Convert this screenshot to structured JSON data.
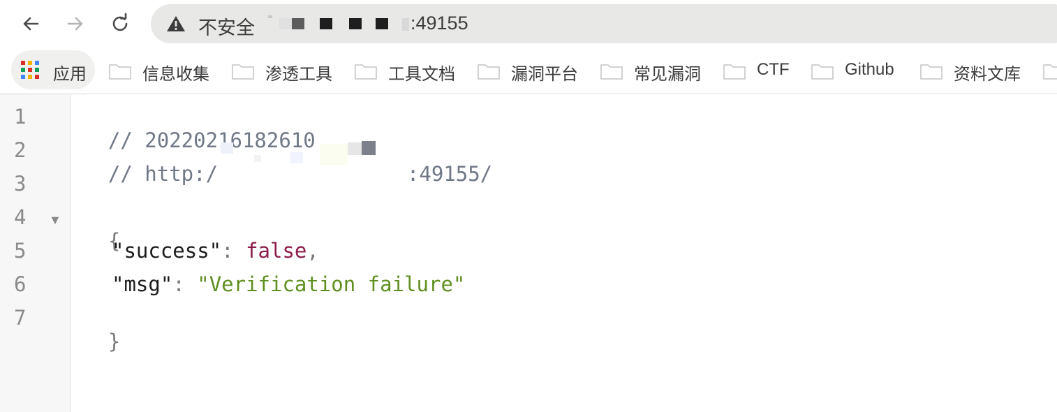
{
  "browser": {
    "security_label": "不安全",
    "url_suffix": ":49155"
  },
  "bookmarks": {
    "apps_label": "应用",
    "items": [
      {
        "label": "信息收集"
      },
      {
        "label": "渗透工具"
      },
      {
        "label": "工具文档"
      },
      {
        "label": "漏洞平台"
      },
      {
        "label": "常见漏洞"
      },
      {
        "label": "CTF"
      },
      {
        "label": "Github"
      },
      {
        "label": "资料文库"
      }
    ]
  },
  "viewer": {
    "line_numbers": [
      "1",
      "2",
      "3",
      "4",
      "5",
      "6",
      "7"
    ],
    "comment_timestamp": "// 20220216182610",
    "comment_url_prefix": "// http:/",
    "comment_url_suffix": ":49155/",
    "open_brace": "{",
    "close_brace": "}",
    "key_success": "\"success\"",
    "value_success": "false",
    "key_msg": "\"msg\"",
    "value_msg": "\"Verification failure\"",
    "colon": ":",
    "comma": ",",
    "colors": {
      "comment": "#6f7886",
      "boolean": "#8c1c4a",
      "string": "#5f8f1f"
    }
  }
}
